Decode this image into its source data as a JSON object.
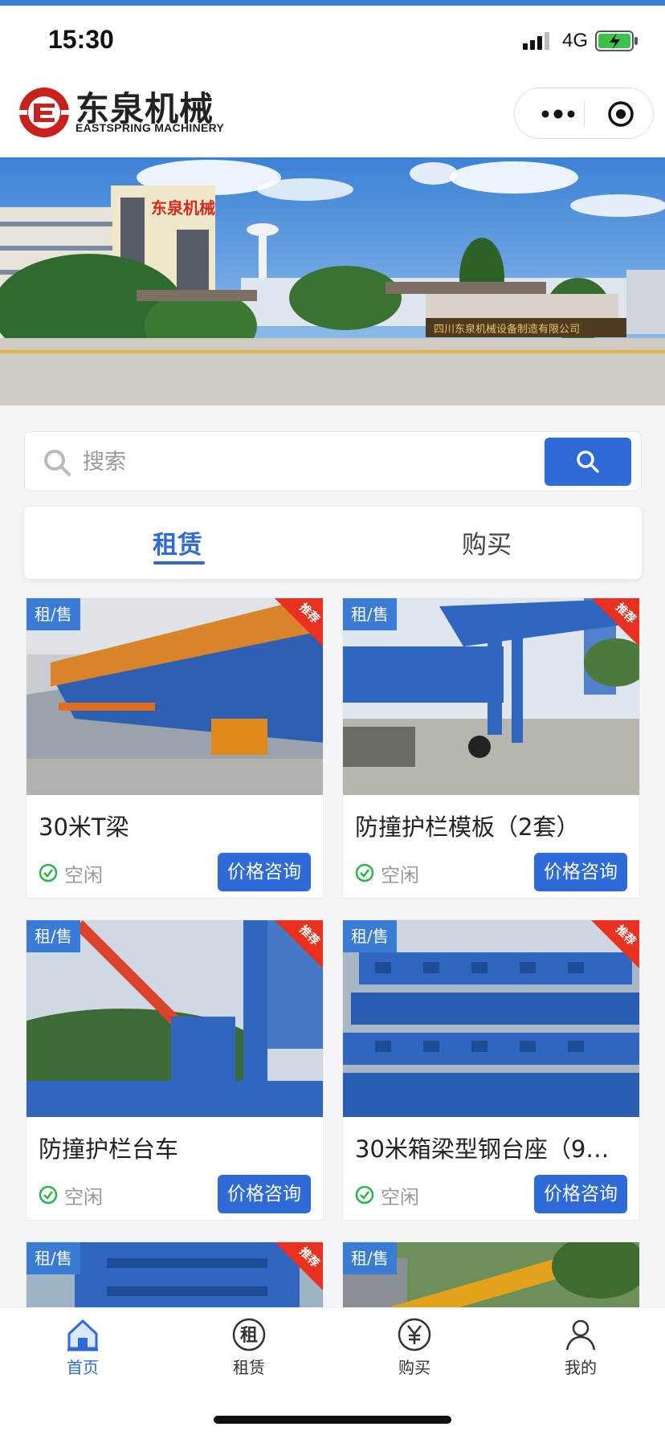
{
  "status_bar": {
    "time": "15:30",
    "network": "4G"
  },
  "header": {
    "brand_cn": "东泉机械",
    "brand_en": "EASTSPRING MACHINERY",
    "logo_icon": "eastspring-logo",
    "more_icon": "more-dots-icon",
    "close_icon": "target-circle-icon"
  },
  "banner": {
    "building_sign": "东泉机械",
    "gate_sign": "四川东泉机械设备制造有限公司",
    "dots_count": 4,
    "active_dot": 1
  },
  "search": {
    "placeholder": "搜索",
    "button_icon": "search-icon"
  },
  "tabs": [
    {
      "label": "租赁",
      "active": true
    },
    {
      "label": "购买",
      "active": false
    }
  ],
  "products": [
    {
      "tag": "租/售",
      "ribbon": "推荐",
      "title": "30米T梁",
      "status": "空闲",
      "action": "价格咨询"
    },
    {
      "tag": "租/售",
      "ribbon": "推荐",
      "title": "防撞护栏模板（2套）",
      "status": "空闲",
      "action": "价格咨询"
    },
    {
      "tag": "租/售",
      "ribbon": "推荐",
      "title": "防撞护栏台车",
      "status": "空闲",
      "action": "价格咨询"
    },
    {
      "tag": "租/售",
      "ribbon": "推荐",
      "title": "30米箱梁型钢台座（9…",
      "status": "空闲",
      "action": "价格咨询"
    },
    {
      "tag": "租/售",
      "ribbon": "推荐"
    },
    {
      "tag": "租/售"
    }
  ],
  "tabbar": [
    {
      "label": "首页",
      "icon": "home-icon",
      "active": true
    },
    {
      "label": "租赁",
      "icon": "rent-icon",
      "active": false
    },
    {
      "label": "购买",
      "icon": "yen-icon",
      "active": false
    },
    {
      "label": "我的",
      "icon": "user-icon",
      "active": false
    }
  ],
  "colors": {
    "accent": "#2f6bd6",
    "tag": "#3a7bd5",
    "ribbon": "#e8321f",
    "ok": "#2fb24a"
  }
}
